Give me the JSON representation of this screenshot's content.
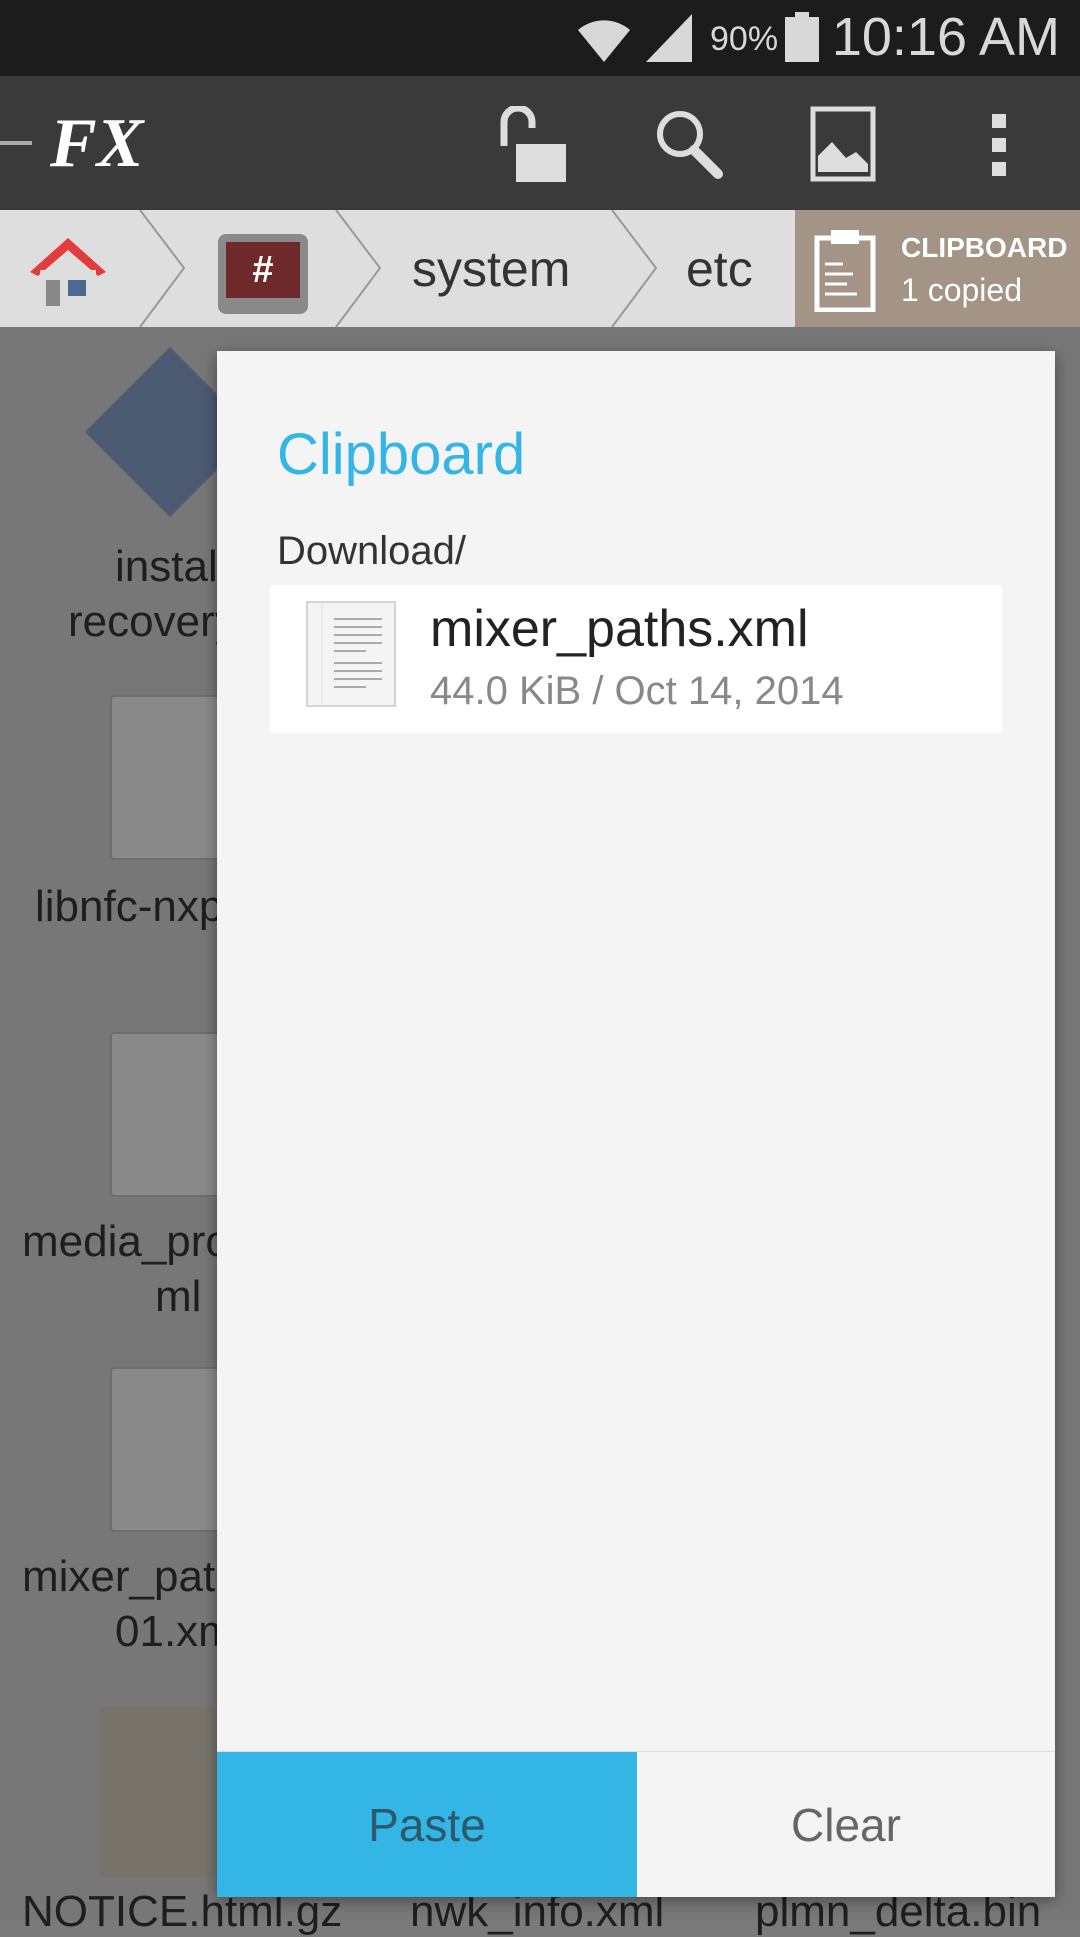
{
  "status_bar": {
    "battery": "90%",
    "time": "10:16 AM"
  },
  "toolbar": {
    "logo": "FX",
    "icons": [
      "unlock-icon",
      "search-icon",
      "image-icon",
      "overflow-menu-icon"
    ]
  },
  "breadcrumb": {
    "items": [
      "home",
      "root",
      "system",
      "etc"
    ]
  },
  "clipboard_button": {
    "title": "CLIPBOARD",
    "count": "1 copied"
  },
  "background_files": [
    "instal",
    "recovery",
    "libnfc-nxp",
    "media_pro",
    "ml",
    "mixer_pat",
    "01.xm",
    "NOTICE.html.gz",
    "nwk_info.xml",
    "plmn_delta.bin"
  ],
  "dialog": {
    "title": "Clipboard",
    "path": "Download/",
    "item": {
      "name": "mixer_paths.xml",
      "meta": "44.0 KiB / Oct 14, 2014"
    },
    "paste_label": "Paste",
    "clear_label": "Clear"
  },
  "colors": {
    "accent": "#33b5e5",
    "clipboard": "#a49486"
  }
}
